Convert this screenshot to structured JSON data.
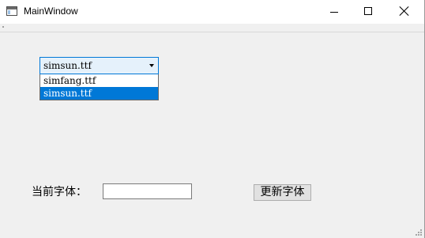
{
  "window": {
    "title": "MainWindow"
  },
  "titlebar_buttons": {
    "minimize_icon": "minimize-icon",
    "maximize_icon": "maximize-icon",
    "close_icon": "close-icon"
  },
  "font_combo": {
    "selected": "simsun.ttf",
    "options": [
      "simfang.ttf",
      "simsun.ttf"
    ],
    "highlighted": "simsun.ttf"
  },
  "current_font": {
    "label": "当前字体：",
    "value": ""
  },
  "update_button": {
    "label": "更新字体"
  },
  "colors": {
    "accent": "#0078d7",
    "window_bg": "#f0f0f0",
    "combo_bg": "#e5f1fb"
  }
}
